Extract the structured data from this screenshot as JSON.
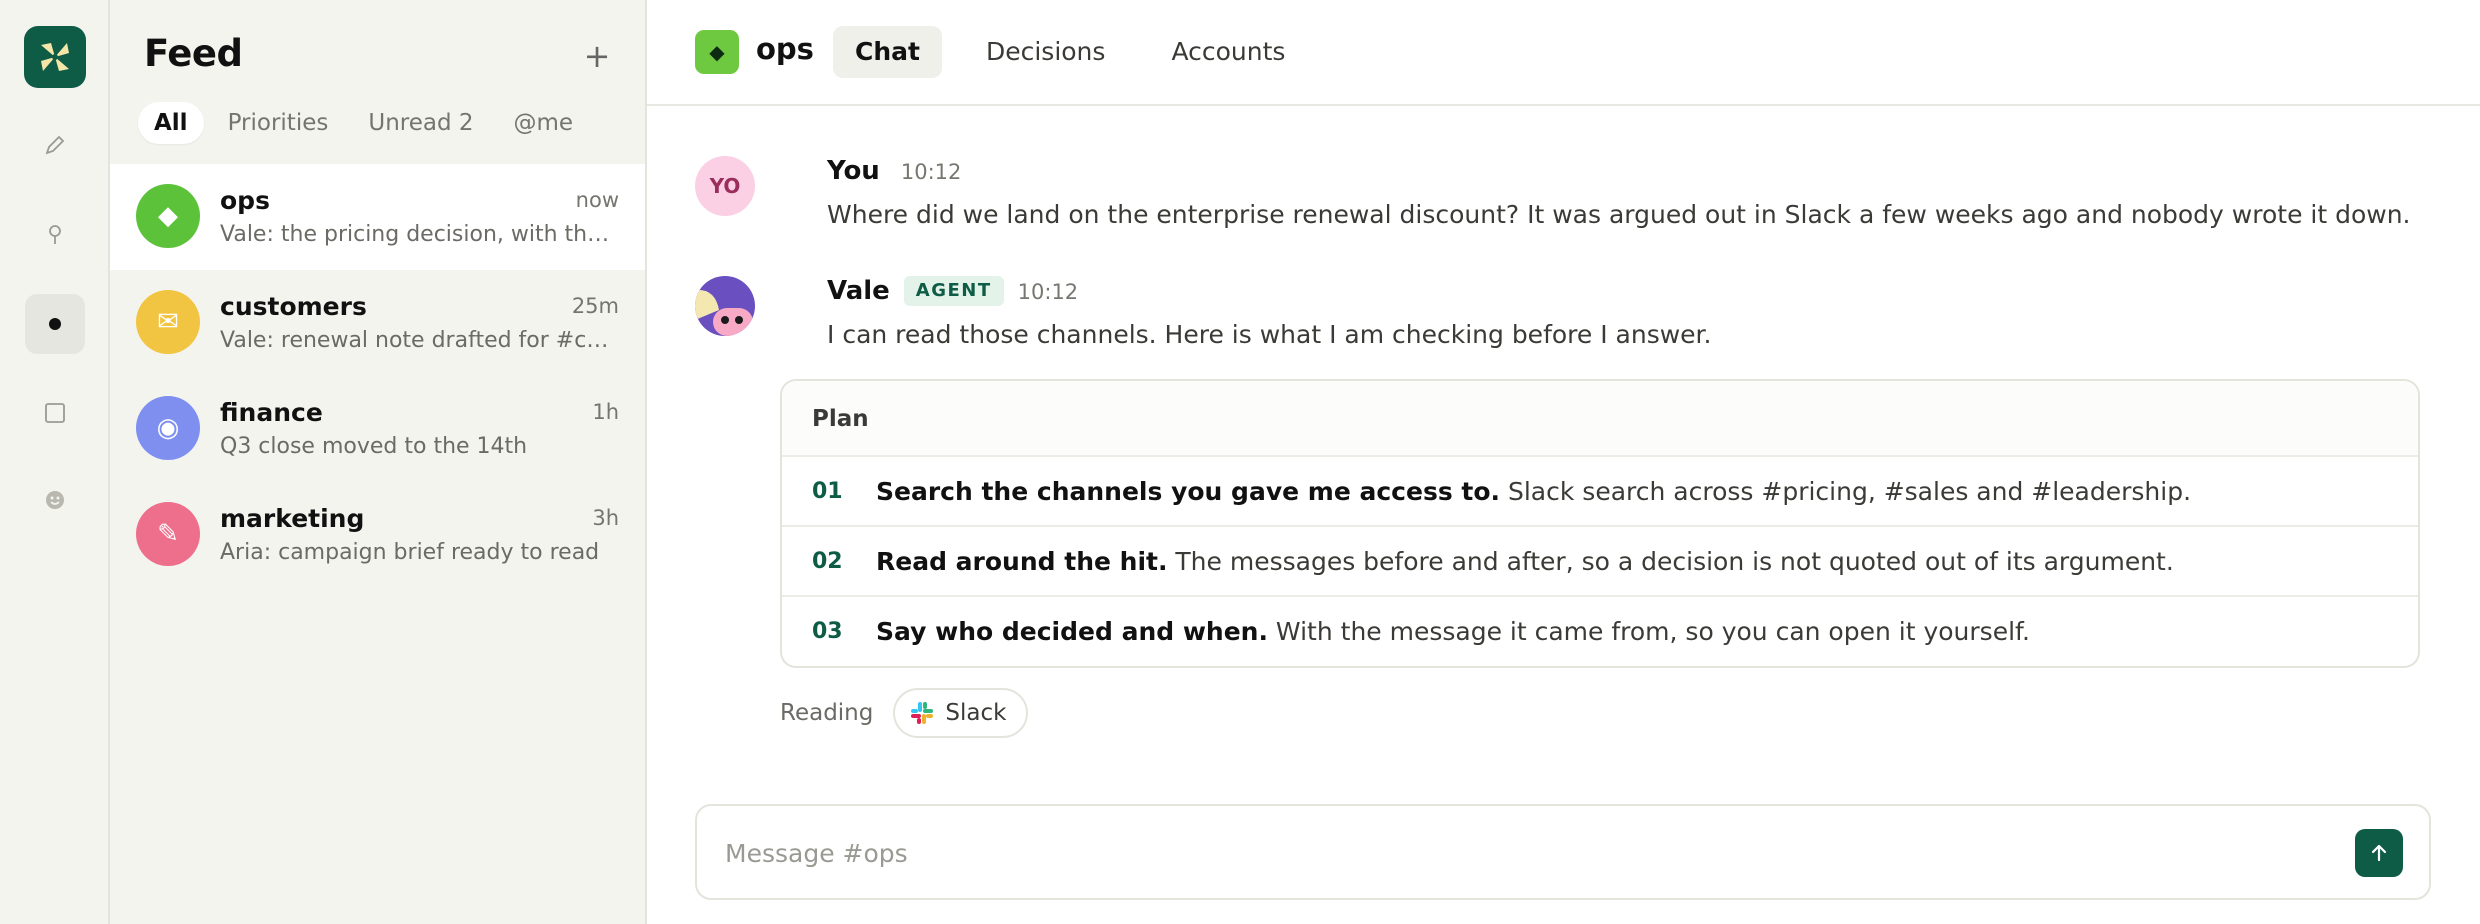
{
  "rail": {
    "items": [
      {
        "icon": "edit-icon"
      },
      {
        "icon": "search-icon"
      },
      {
        "icon": "feed-dot-icon",
        "active": true
      },
      {
        "icon": "square-icon"
      },
      {
        "icon": "smiley-icon"
      }
    ]
  },
  "feed": {
    "title": "Feed",
    "add_label": "+",
    "filters": [
      {
        "label": "All",
        "active": true
      },
      {
        "label": "Priorities"
      },
      {
        "label": "Unread 2"
      },
      {
        "label": "@me"
      }
    ],
    "items": [
      {
        "name": "ops",
        "time": "now",
        "preview": "Vale: the pricing decision, with the thread it came from",
        "icon": "diamond-icon",
        "glyph": "◆",
        "color": "#5cc23a",
        "active": true
      },
      {
        "name": "customers",
        "time": "25m",
        "preview": "Vale: renewal note drafted for #customers",
        "icon": "mail-icon",
        "glyph": "✉",
        "color": "#f1c441"
      },
      {
        "name": "finance",
        "time": "1h",
        "preview": "Q3 close moved to the 14th",
        "icon": "target-icon",
        "glyph": "◉",
        "color": "#7f8ff0"
      },
      {
        "name": "marketing",
        "time": "3h",
        "preview": "Aria: campaign brief ready to read",
        "icon": "pencil-icon",
        "glyph": "✎",
        "color": "#ee6f8c"
      }
    ]
  },
  "header": {
    "channel": "ops",
    "channel_glyph": "◆",
    "tabs": [
      {
        "label": "Chat",
        "active": true
      },
      {
        "label": "Decisions"
      },
      {
        "label": "Accounts"
      }
    ]
  },
  "messages": [
    {
      "avatar_text": "YO",
      "author": "You",
      "time": "10:12",
      "text": "Where did we land on the enterprise renewal discount? It was argued out in Slack a few weeks ago and nobody wrote it down."
    },
    {
      "author": "Vale",
      "badge": "AGENT",
      "time": "10:12",
      "text": "I can read those channels. Here is what I am checking before I answer."
    }
  ],
  "plan": {
    "title": "Plan",
    "steps": [
      {
        "num": "01",
        "bold": "Search the channels you gave me access to.",
        "rest": " Slack search across #pricing, #sales and #leadership."
      },
      {
        "num": "02",
        "bold": "Read around the hit.",
        "rest": " The messages before and after, so a decision is not quoted out of its argument."
      },
      {
        "num": "03",
        "bold": "Say who decided and when.",
        "rest": " With the message it came from, so you can open it yourself."
      }
    ]
  },
  "reading": {
    "label": "Reading",
    "source": "Slack"
  },
  "composer": {
    "placeholder": "Message #ops",
    "send_icon": "arrow-up-icon"
  },
  "colors": {
    "brand": "#0e5c46",
    "channel_badge": "#6ec941",
    "agent_badge_bg": "#e3f3ea"
  }
}
